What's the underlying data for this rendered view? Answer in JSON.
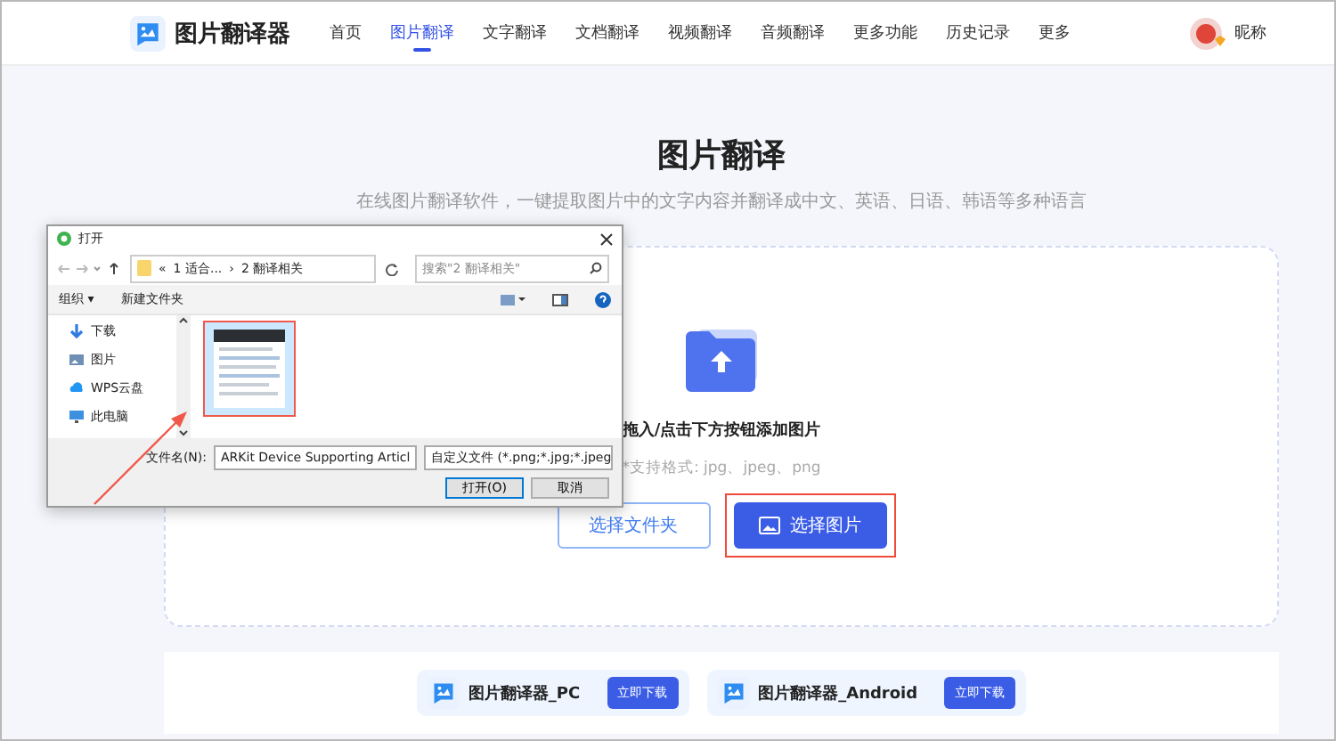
{
  "header": {
    "brand": "图片翻译器",
    "nav": [
      {
        "label": "首页",
        "selected": false
      },
      {
        "label": "图片翻译",
        "selected": true
      },
      {
        "label": "文字翻译",
        "selected": false
      },
      {
        "label": "文档翻译",
        "selected": false
      },
      {
        "label": "视频翻译",
        "selected": false
      },
      {
        "label": "音频翻译",
        "selected": false
      },
      {
        "label": "更多功能",
        "selected": false
      },
      {
        "label": "历史记录",
        "selected": false
      },
      {
        "label": "更多",
        "selected": false
      }
    ],
    "user": "昵称"
  },
  "main": {
    "title": "图片翻译",
    "subtitle": "在线图片翻译软件，一键提取图片中的文字内容并翻译成中文、英语、日语、韩语等多种语言",
    "upload": {
      "prompt": "拖入/点击下方按钮添加图片",
      "hint": "*支持格式: jpg、jpeg、png",
      "buttons": [
        {
          "label": "选择文件夹",
          "kind": "outline",
          "highlighted": false
        },
        {
          "label": "选择图片",
          "kind": "primary",
          "highlighted": true
        }
      ]
    }
  },
  "downloads": [
    {
      "name": "图片翻译器_PC",
      "button": "立即下载"
    },
    {
      "name": "图片翻译器_Android",
      "button": "立即下载"
    }
  ],
  "dialog": {
    "title": "打开",
    "path": [
      "«",
      "1 适合...",
      "›",
      "2 翻译相关"
    ],
    "search": {
      "placeholder": "搜索\"2 翻译相关\""
    },
    "toolbar": [
      "组织 ▾",
      "新建文件夹"
    ],
    "nav": [
      {
        "label": "下载",
        "kind": "download"
      },
      {
        "label": "图片",
        "kind": "pictures"
      },
      {
        "label": "WPS云盘",
        "kind": "cloud"
      },
      {
        "label": "此电脑",
        "kind": "computer"
      }
    ],
    "files": [
      {
        "kind": "picture",
        "selected": true
      }
    ],
    "filename_label": "文件名(N):",
    "filename": "ARKit Device Supporting Articl",
    "filter": "自定义文件 (*.png;*.jpg;*.jpeg",
    "buttons": [
      "打开(O)",
      "取消"
    ]
  }
}
